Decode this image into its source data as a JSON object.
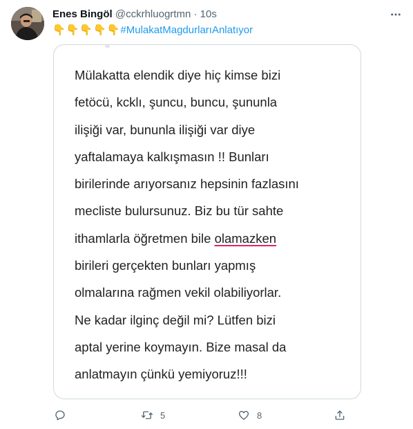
{
  "author": {
    "name": "Enes Bingöl",
    "handle": "@cckrhluogrtmn",
    "separator": "·",
    "time": "10s"
  },
  "tweet": {
    "emojis": "👇👇👇👇👇",
    "hashtag": "#MulakatMagdurlarıAnlatıyor"
  },
  "note": {
    "before_underline": "Mülakatta elendik diye hiç kimse bizi\nfetöcü, kcklı, şuncu, buncu, şununla\nilişiği var, bununla ilişiği var diye\nyaftalamaya kalkışmasın !! Bunları\nbirilerinde arıyorsanız hepsinin fazlasını\nmecliste bulursunuz. Biz bu tür sahte\nithamlarla öğretmen bile ",
    "underlined": "olamazken",
    "after_underline": "\nbirileri gerçekten bunları yapmış\nolmalarına rağmen vekil olabiliyorlar.\nNe kadar ilginç değil mi? Lütfen bizi\naptal yerine koymayın. Bize masal da\nanlatmayın çünkü yemiyoruz!!!"
  },
  "actions": {
    "reply_count": "",
    "retweet_count": "5",
    "like_count": "8",
    "share_count": ""
  },
  "icons": {
    "reply": "reply-icon",
    "retweet": "retweet-icon",
    "like": "heart-icon",
    "share": "share-icon",
    "more": "more-icon"
  },
  "colors": {
    "accent": "#1d9bf0",
    "secondary_text": "#536471",
    "border": "#cfd9de",
    "underline": "#e0245e"
  }
}
